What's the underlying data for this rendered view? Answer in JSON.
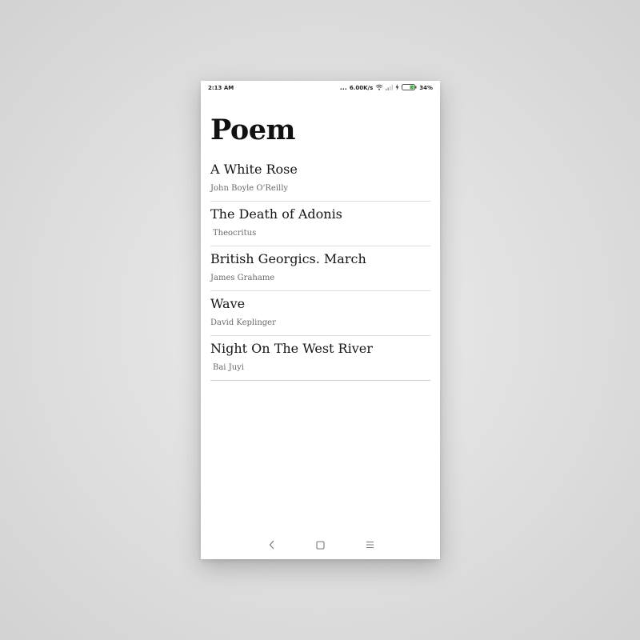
{
  "status_bar": {
    "time": "2:13 AM",
    "more": "...",
    "speed": "6.00K/s",
    "battery_percent": "34%",
    "battery_level": 0.34,
    "battery_color": "#4caf50"
  },
  "page": {
    "title": "Poem"
  },
  "poems": [
    {
      "title": "A White Rose",
      "author": "John Boyle O'Reilly"
    },
    {
      "title": "The Death of Adonis",
      "author": "Theocritus"
    },
    {
      "title": "British Georgics. March",
      "author": "James Grahame"
    },
    {
      "title": "Wave",
      "author": "David Keplinger"
    },
    {
      "title": "Night On The West River",
      "author": "Bai Juyi"
    }
  ],
  "nav": {
    "back_icon": "back-chevron-icon",
    "home_icon": "home-square-icon",
    "menu_icon": "menu-lines-icon"
  }
}
